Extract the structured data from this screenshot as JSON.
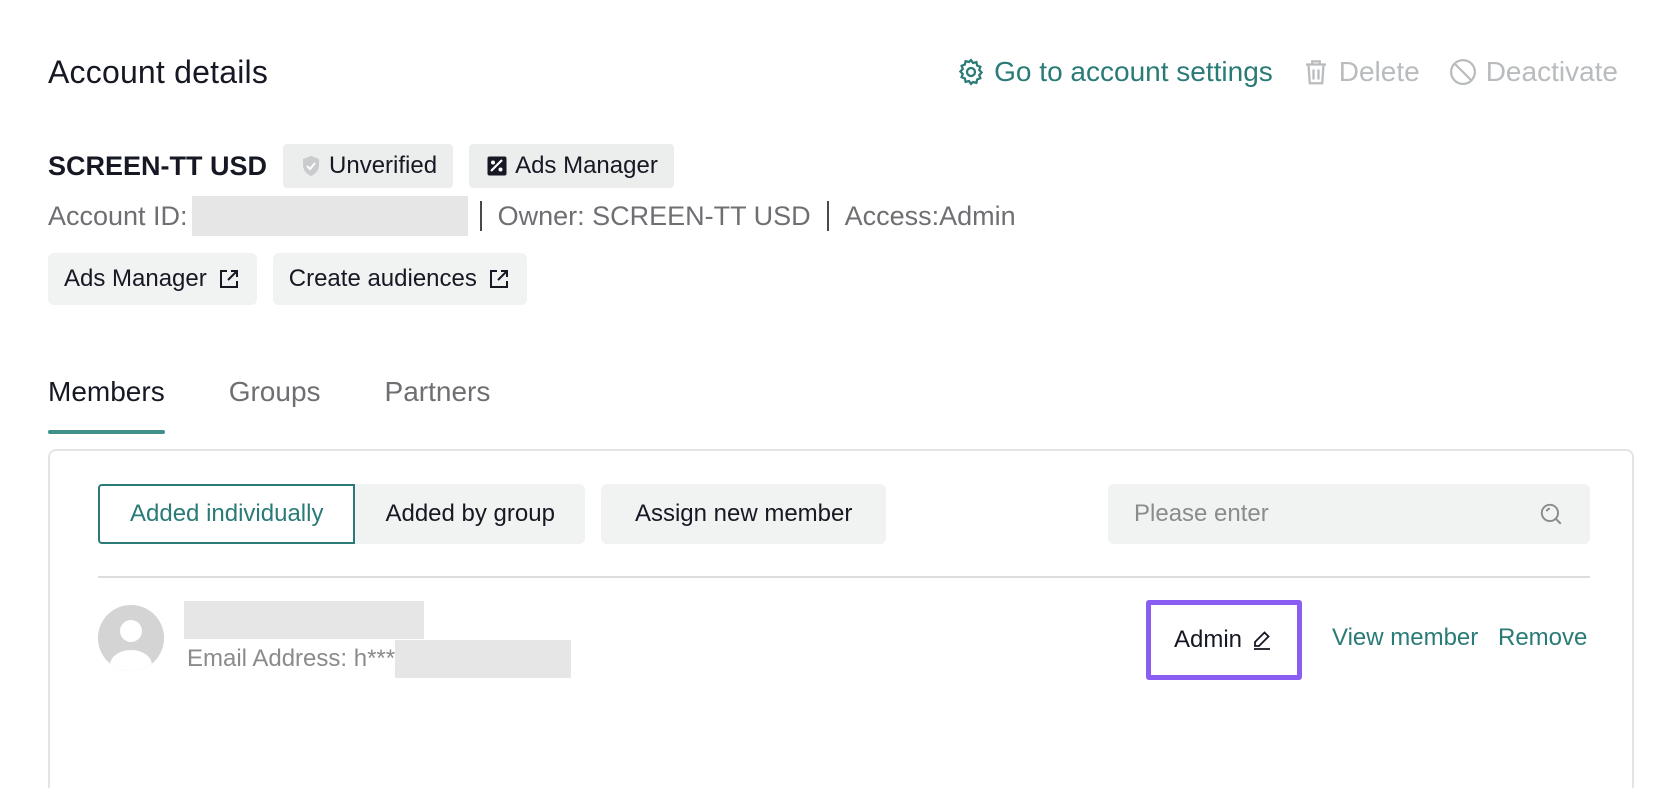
{
  "header": {
    "title": "Account details",
    "settings_label": "Go to account settings",
    "delete_label": "Delete",
    "deactivate_label": "Deactivate"
  },
  "account": {
    "name": "SCREEN-TT USD",
    "status_tag": "Unverified",
    "type_tag": "Ads Manager",
    "id_label": "Account ID:",
    "owner_text": "Owner: SCREEN-TT USD",
    "access_text": "Access:Admin"
  },
  "links": {
    "ads_manager": "Ads Manager",
    "create_audiences": "Create audiences"
  },
  "tabs": [
    {
      "label": "Members"
    },
    {
      "label": "Groups"
    },
    {
      "label": "Partners"
    }
  ],
  "filters": {
    "individual": "Added individually",
    "group": "Added by group",
    "assign": "Assign new member"
  },
  "search": {
    "placeholder": "Please enter"
  },
  "members": [
    {
      "email_prefix": "Email Address: h***",
      "role": "Admin",
      "view_label": "View member",
      "remove_label": "Remove"
    }
  ],
  "colors": {
    "accent": "#2a7b77",
    "highlight": "#8a5cf0",
    "disabled": "#b9bcbe"
  }
}
